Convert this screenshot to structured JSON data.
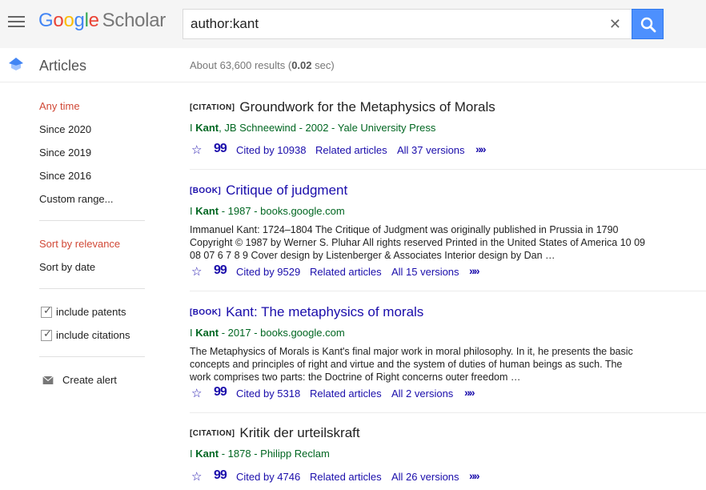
{
  "header": {
    "logo": {
      "google_letters": [
        "G",
        "o",
        "o",
        "g",
        "l",
        "e"
      ],
      "product": "Scholar"
    },
    "search": {
      "value": "author:kant"
    },
    "colors": {
      "search_button": "#4d90fe",
      "link": "#1a0dab",
      "green": "#006621",
      "active": "#d14836"
    }
  },
  "subheader": {
    "title": "Articles",
    "results_prefix": "About 63,600 results (",
    "results_time": "0.02",
    "results_suffix": " sec)"
  },
  "sidebar": {
    "time_filters": [
      "Any time",
      "Since 2020",
      "Since 2019",
      "Since 2016",
      "Custom range..."
    ],
    "sort_options": [
      "Sort by relevance",
      "Sort by date"
    ],
    "checkboxes": [
      "include patents",
      "include citations"
    ],
    "create_alert": "Create alert"
  },
  "results": [
    {
      "type": "[CITATION]",
      "title": "Groundwork for the Metaphysics of Morals",
      "author_prefix": "I ",
      "author_bold": "Kant",
      "author_rest": ", JB Schneewind - 2002 - Yale University Press",
      "snippet": "",
      "cited_by": "Cited by 10938",
      "related": "Related articles",
      "versions": "All 37 versions"
    },
    {
      "type": "[BOOK]",
      "title": "Critique of judgment",
      "author_prefix": "I ",
      "author_bold": "Kant",
      "author_rest": " - 1987 - books.google.com",
      "snippet": "Immanuel Kant: 1724–1804 The Critique of Judgment was originally published in Prussia in 1790 Copyright © 1987 by Werner S. Pluhar All rights reserved Printed in the United States of America 10 09 08 07 6 7 8 9 Cover design by Listenberger & Associates Interior design by Dan …",
      "cited_by": "Cited by 9529",
      "related": "Related articles",
      "versions": "All 15 versions"
    },
    {
      "type": "[BOOK]",
      "title": "Kant: The metaphysics of morals",
      "author_prefix": "I ",
      "author_bold": "Kant",
      "author_rest": " - 2017 - books.google.com",
      "snippet": "The Metaphysics of Morals is Kant's final major work in moral philosophy. In it, he presents the basic concepts and principles of right and virtue and the system of duties of human beings as such. The work comprises two parts: the Doctrine of Right concerns outer freedom …",
      "cited_by": "Cited by 5318",
      "related": "Related articles",
      "versions": "All 2 versions"
    },
    {
      "type": "[CITATION]",
      "title": "Kritik der urteilskraft",
      "author_prefix": "I ",
      "author_bold": "Kant",
      "author_rest": " - 1878 - Philipp Reclam",
      "snippet": "",
      "cited_by": "Cited by 4746",
      "related": "Related articles",
      "versions": "All 26 versions"
    }
  ]
}
